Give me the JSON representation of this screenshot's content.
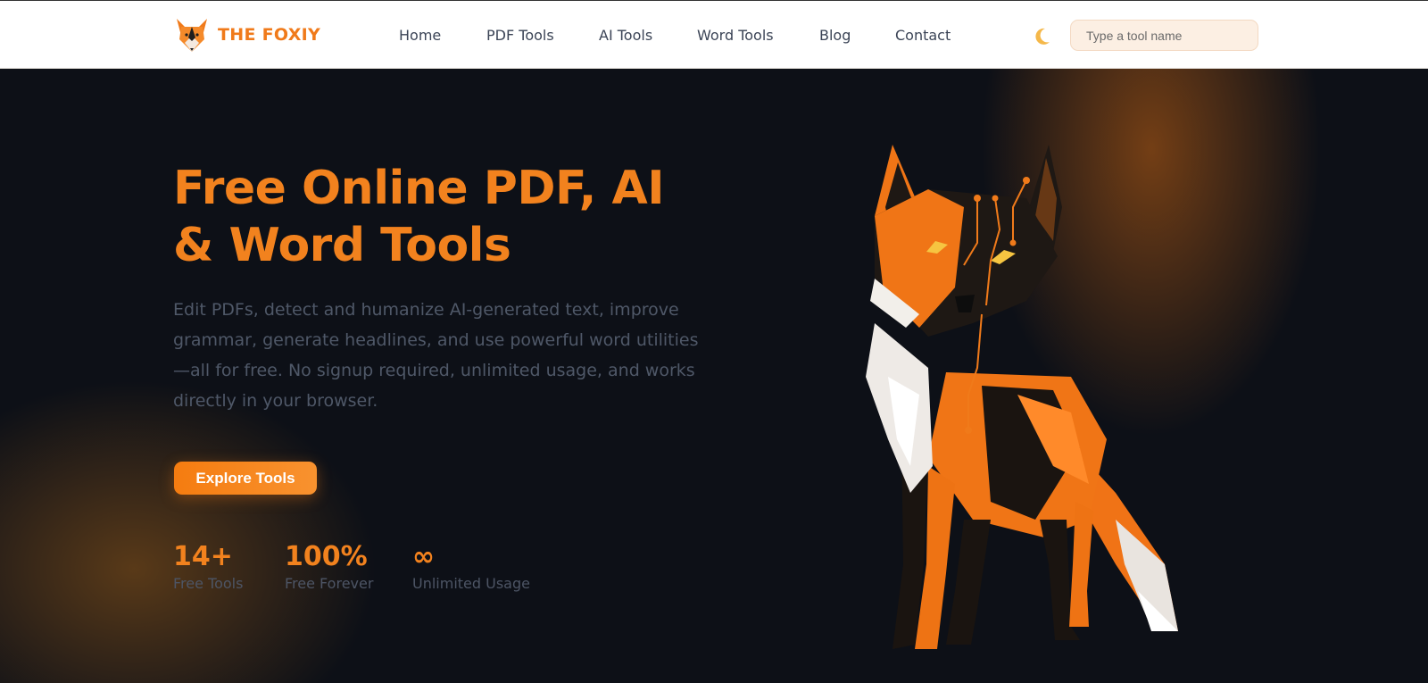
{
  "brand": {
    "name": "THE FOXIY",
    "logo_icon": "fox-logo-icon"
  },
  "nav": {
    "items": [
      "Home",
      "PDF Tools",
      "AI Tools",
      "Word Tools",
      "Blog",
      "Contact"
    ]
  },
  "header": {
    "theme_icon": "moon-icon",
    "search_placeholder": "Type a tool name"
  },
  "hero": {
    "title": "Free Online PDF, AI & Word Tools",
    "description": "Edit PDFs, detect and humanize AI-generated text, improve grammar, generate headlines, and use powerful word utilities—all for free. No signup required, unlimited usage, and works directly in your browser.",
    "cta_label": "Explore Tools",
    "stats": [
      {
        "value": "14+",
        "label": "Free Tools"
      },
      {
        "value": "100%",
        "label": "Free Forever"
      },
      {
        "value": "∞",
        "label": "Unlimited Usage"
      }
    ],
    "illustration": "geometric-circuit-fox-illustration"
  },
  "colors": {
    "accent": "#f2821e",
    "background": "#0d1017",
    "header_bg": "#ffffff",
    "search_bg": "#fcefe3"
  }
}
